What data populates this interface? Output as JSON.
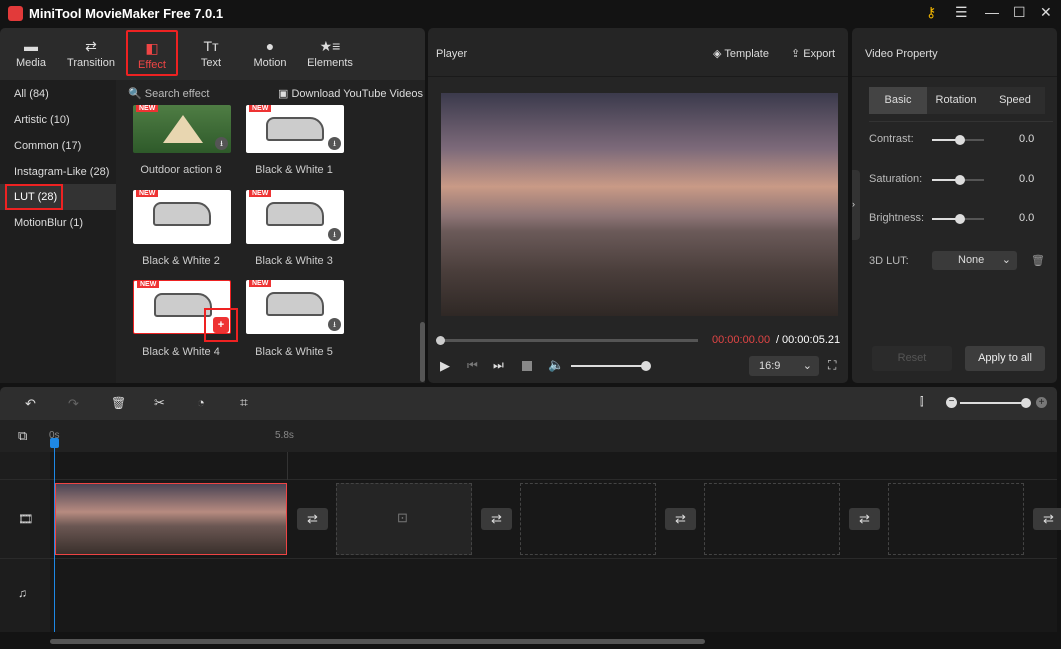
{
  "app": {
    "title": "MiniTool MovieMaker Free 7.0.1"
  },
  "toolbar": [
    {
      "label": "Media",
      "icon": "folder-icon"
    },
    {
      "label": "Transition",
      "icon": "swap-arrows-icon"
    },
    {
      "label": "Effect",
      "icon": "effect-icon",
      "active": true
    },
    {
      "label": "Text",
      "icon": "text-icon"
    },
    {
      "label": "Motion",
      "icon": "motion-icon"
    },
    {
      "label": "Elements",
      "icon": "elements-icon"
    }
  ],
  "categories": [
    "All (84)",
    "Artistic (10)",
    "Common (17)",
    "Instagram-Like (28)",
    "LUT (28)",
    "MotionBlur (1)"
  ],
  "selected_category": "LUT (28)",
  "search": {
    "placeholder": "Search effect"
  },
  "download_youtube": "Download YouTube Videos",
  "effects": [
    {
      "label": "Outdoor action 8",
      "badge": "NEW"
    },
    {
      "label": "Black & White 1",
      "badge": "NEW"
    },
    {
      "label": "Black & White 2",
      "badge": "NEW"
    },
    {
      "label": "Black & White 3",
      "badge": "NEW"
    },
    {
      "label": "Black & White 4",
      "badge": "NEW"
    },
    {
      "label": "Black & White 5",
      "badge": "NEW"
    }
  ],
  "player": {
    "title": "Player",
    "template": "Template",
    "export": "Export",
    "current_time": "00:00:00.00",
    "separator": "/",
    "total_time": "00:00:05.21",
    "aspect": "16:9",
    "progress": 0,
    "volume": 1.0
  },
  "property": {
    "title": "Video Property",
    "tabs": [
      "Basic",
      "Rotation",
      "Speed"
    ],
    "active_tab": "Basic",
    "sliders": [
      {
        "label": "Contrast:",
        "value": "0.0"
      },
      {
        "label": "Saturation:",
        "value": "0.0"
      },
      {
        "label": "Brightness:",
        "value": "0.0"
      }
    ],
    "lut_label": "3D LUT:",
    "lut_value": "None",
    "reset": "Reset",
    "apply_all": "Apply to all"
  },
  "timeline": {
    "ticks": [
      "0s",
      "5.8s"
    ]
  },
  "colors": {
    "accent": "#e53935",
    "playhead": "#1e88e5",
    "bg": "#131313"
  }
}
